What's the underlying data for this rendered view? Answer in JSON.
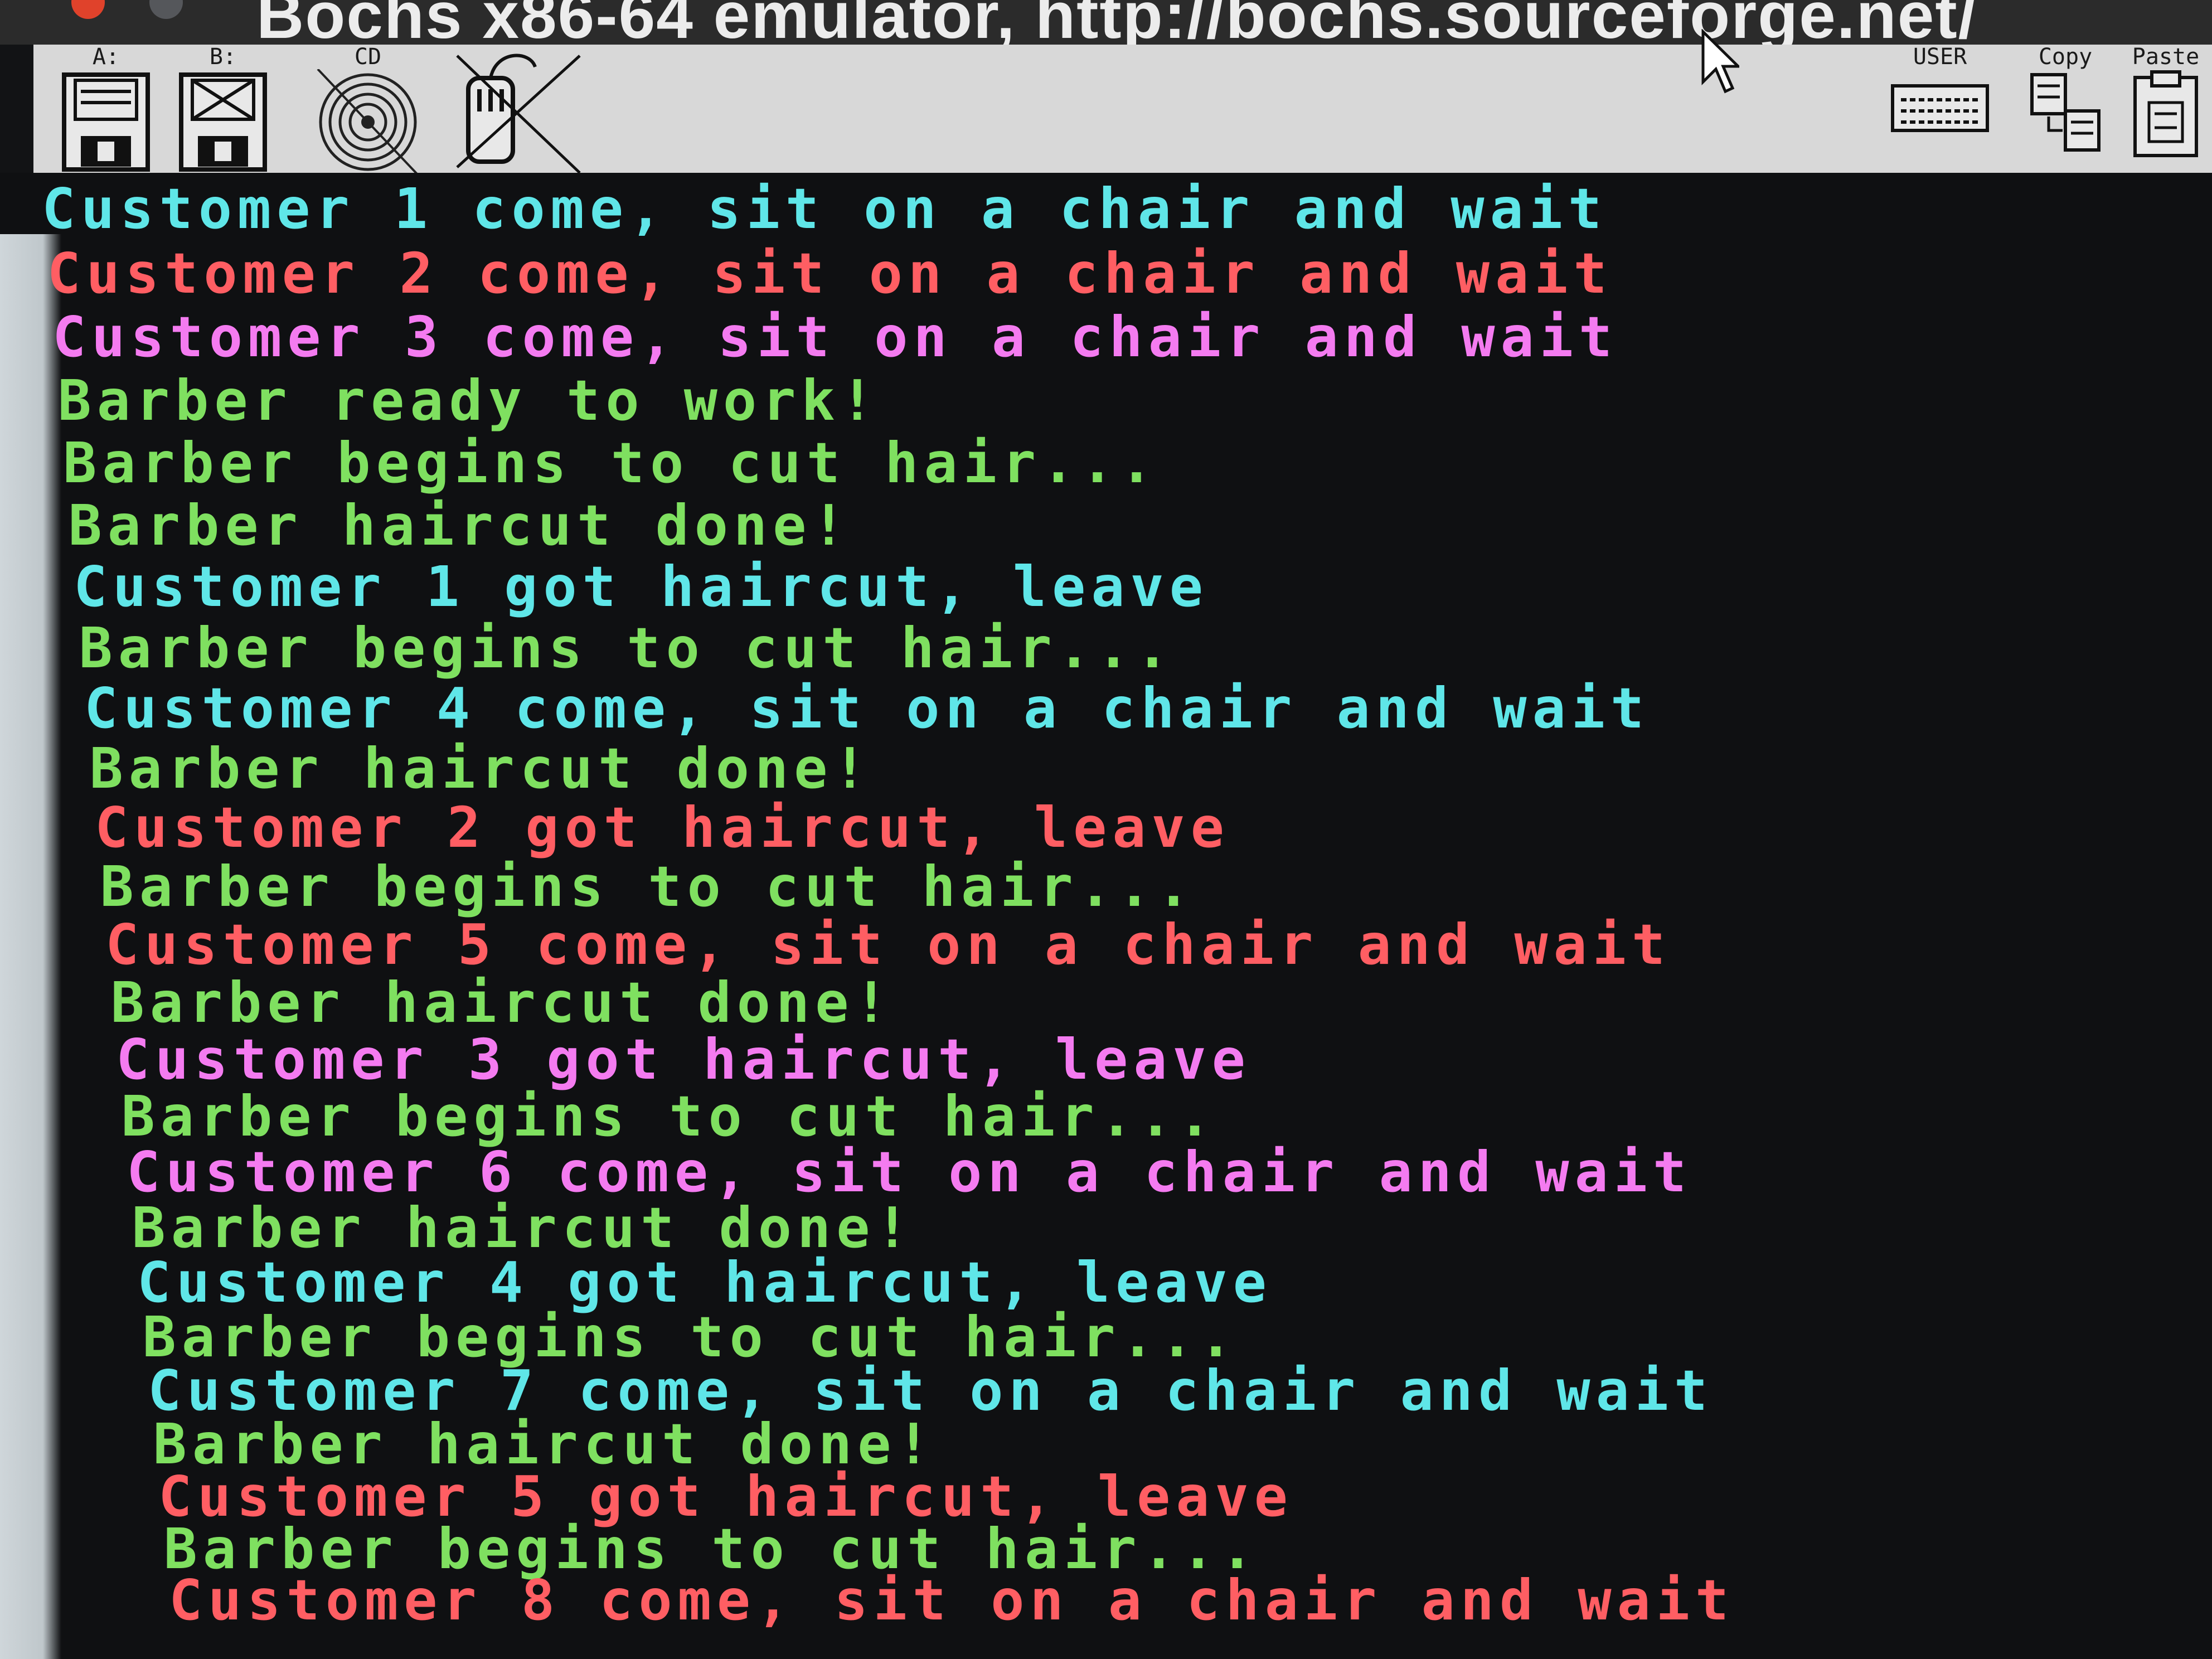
{
  "window": {
    "title": "Bochs x86-64 emulator, http://bochs.sourceforge.net/"
  },
  "toolbar": {
    "floppy_a_label": "A:",
    "floppy_b_label": "B:",
    "cdrom_label": "CD",
    "user_label": "USER",
    "copy_label": "Copy",
    "paste_label": "Paste"
  },
  "colors": {
    "cyan": "#5fe6e8",
    "red": "#ff5e63",
    "magenta": "#f47bf0",
    "green": "#7fe060",
    "console_bg": "#0f1012"
  },
  "console": {
    "lines": [
      {
        "text": "Customer 1 come, sit on a chair and wait",
        "color": "cyan"
      },
      {
        "text": "Customer 2 come, sit on a chair and wait",
        "color": "red"
      },
      {
        "text": "Customer 3 come, sit on a chair and wait",
        "color": "magenta"
      },
      {
        "text": "Barber ready to work!",
        "color": "green"
      },
      {
        "text": "Barber begins to cut hair...",
        "color": "green"
      },
      {
        "text": "Barber haircut done!",
        "color": "green"
      },
      {
        "text": "Customer 1 got haircut, leave",
        "color": "cyan"
      },
      {
        "text": "Barber begins to cut hair...",
        "color": "green"
      },
      {
        "text": "Customer 4 come, sit on a chair and wait",
        "color": "cyan"
      },
      {
        "text": "Barber haircut done!",
        "color": "green"
      },
      {
        "text": "Customer 2 got haircut, leave",
        "color": "red"
      },
      {
        "text": "Barber begins to cut hair...",
        "color": "green"
      },
      {
        "text": "Customer 5 come, sit on a chair and wait",
        "color": "red"
      },
      {
        "text": "Barber haircut done!",
        "color": "green"
      },
      {
        "text": "Customer 3 got haircut, leave",
        "color": "magenta"
      },
      {
        "text": "Barber begins to cut hair...",
        "color": "green"
      },
      {
        "text": "Customer 6 come, sit on a chair and wait",
        "color": "magenta"
      },
      {
        "text": "Barber haircut done!",
        "color": "green"
      },
      {
        "text": "Customer 4 got haircut, leave",
        "color": "cyan"
      },
      {
        "text": "Barber begins to cut hair...",
        "color": "green"
      },
      {
        "text": "Customer 7 come, sit on a chair and wait",
        "color": "cyan"
      },
      {
        "text": "Barber haircut done!",
        "color": "green"
      },
      {
        "text": "Customer 5 got haircut, leave",
        "color": "red"
      },
      {
        "text": "Barber begins to cut hair...",
        "color": "green"
      },
      {
        "text": "Customer 8 come, sit on a chair and wait",
        "color": "red"
      }
    ]
  }
}
